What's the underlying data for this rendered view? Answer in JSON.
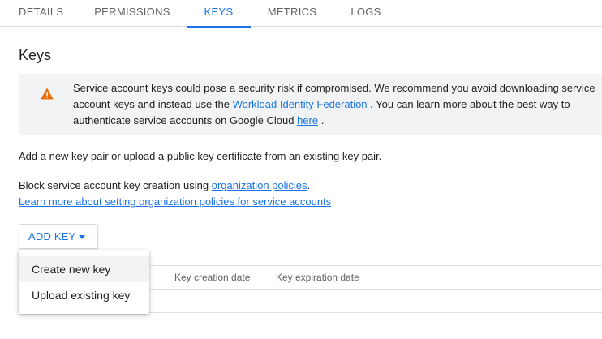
{
  "tabs": [
    {
      "label": "DETAILS",
      "active": false
    },
    {
      "label": "PERMISSIONS",
      "active": false
    },
    {
      "label": "KEYS",
      "active": true
    },
    {
      "label": "METRICS",
      "active": false
    },
    {
      "label": "LOGS",
      "active": false
    }
  ],
  "title": "Keys",
  "warning": {
    "icon": "warning-icon",
    "icon_color": "#e8710a",
    "text_before": "Service account keys could pose a security risk if compromised. We recommend you avoid downloading service account keys and instead use the ",
    "link1": "Workload Identity Federation",
    "text_middle": " . You can learn more about the best way to authenticate service accounts on Google Cloud ",
    "link2": "here",
    "text_after": " ."
  },
  "add_pair_text": "Add a new key pair or upload a public key certificate from an existing key pair.",
  "block": {
    "text": "Block service account key creation using ",
    "link": "organization policies",
    "suffix": "."
  },
  "learn_more": "Learn more about setting organization policies for service accounts",
  "add_key_button": "ADD KEY",
  "table": {
    "headers": [
      "Key creation date",
      "Key expiration date"
    ]
  },
  "menu": {
    "items": [
      "Create new key",
      "Upload existing key"
    ]
  },
  "colors": {
    "accent": "#1a73e8",
    "warning": "#e8710a"
  }
}
